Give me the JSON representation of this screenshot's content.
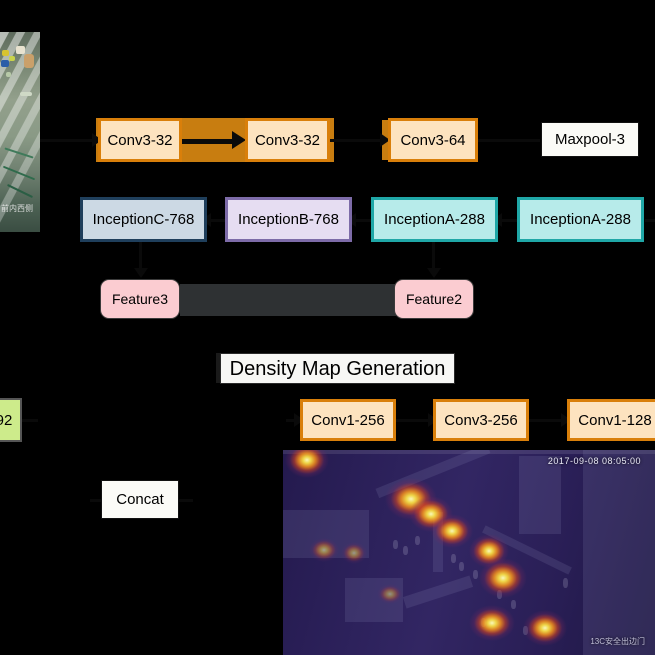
{
  "diagram": {
    "title": "Density Map Generation",
    "background_color": "#000000",
    "nodes": {
      "conv3_32_a": {
        "label": "Conv3-32",
        "fill": "#fde3bf",
        "stroke": "#d97f0a"
      },
      "conv3_32_b": {
        "label": "Conv3-32",
        "fill": "#fde3bf",
        "stroke": "#d97f0a"
      },
      "conv3_64": {
        "label": "Conv3-64",
        "fill": "#fde3bf",
        "stroke": "#d97f0a"
      },
      "maxpool_3": {
        "label": "Maxpool-3",
        "fill": "#ffffff",
        "stroke": "#111111"
      },
      "inceptionC_768": {
        "label": "InceptionC-768",
        "fill": "#ccd9e4",
        "stroke": "#1f3f5c"
      },
      "inceptionB_768": {
        "label": "InceptionB-768",
        "fill": "#e6ddf2",
        "stroke": "#7d6ba8"
      },
      "inceptionA_288_a": {
        "label": "InceptionA-288",
        "fill": "#b7ebea",
        "stroke": "#1fa7a7"
      },
      "inceptionA_288_b": {
        "label": "InceptionA-288",
        "fill": "#b7ebea",
        "stroke": "#1fa7a7"
      },
      "feature3": {
        "label": "Feature3",
        "fill": "#fbccd1",
        "stroke": "#3b3b3b"
      },
      "feature2": {
        "label": "Feature2",
        "fill": "#fbccd1",
        "stroke": "#3b3b3b"
      },
      "density_map_generation": {
        "label": "Density Map Generation",
        "fill": "#f7f7f5",
        "stroke": "#2a2a2a"
      },
      "green_partial": {
        "label": "92",
        "fill": "#cdeb8b",
        "stroke": "#555555"
      },
      "concat": {
        "label": "Concat",
        "fill": "#fbfbf7",
        "stroke": "#111111"
      },
      "conv1_256": {
        "label": "Conv1-256",
        "fill": "#fde3bf",
        "stroke": "#d97f0a"
      },
      "conv3_256": {
        "label": "Conv3-256",
        "fill": "#fde3bf",
        "stroke": "#d97f0a"
      },
      "conv1_128": {
        "label": "Conv1-128",
        "fill": "#fde3bf",
        "stroke": "#d97f0a"
      }
    },
    "images": {
      "input_scene": {
        "name": "input-scene-crop",
        "watermark": "前内西侧"
      },
      "density_heatmap": {
        "name": "density-heatmap",
        "timestamp": "2017-09-08 08:05:00",
        "watermark": "13C安全出边门"
      }
    }
  }
}
